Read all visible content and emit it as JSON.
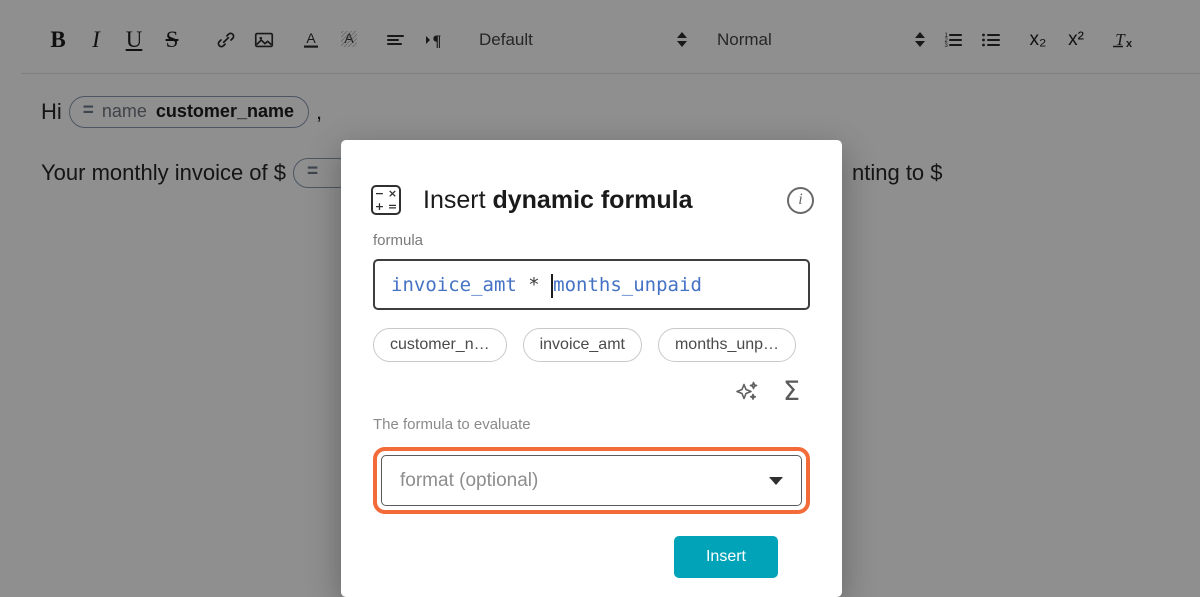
{
  "toolbar": {
    "buttons": [
      {
        "name": "bold",
        "label": "B",
        "icon": "bold-icon"
      },
      {
        "name": "italic",
        "label": "I",
        "icon": "italic-icon"
      },
      {
        "name": "underline",
        "label": "U",
        "icon": "underline-icon"
      },
      {
        "name": "strikethrough",
        "label": "S",
        "icon": "strikethrough-icon"
      },
      {
        "name": "link",
        "label": "🔗",
        "icon": "link-icon"
      },
      {
        "name": "image",
        "label": "🖼",
        "icon": "image-icon"
      },
      {
        "name": "text-color",
        "label": "A",
        "icon": "text-color-icon"
      },
      {
        "name": "highlight",
        "label": "A",
        "icon": "highlight-color-icon"
      },
      {
        "name": "align",
        "label": "≡",
        "icon": "align-left-icon"
      },
      {
        "name": "indent",
        "label": "▸¶",
        "icon": "paragraph-direction-icon"
      }
    ],
    "font_select": {
      "value": "Default"
    },
    "style_select": {
      "value": "Normal"
    },
    "list_buttons": [
      {
        "name": "ordered-list",
        "label": "1⁣2⁣3",
        "icon": "ordered-list-icon"
      },
      {
        "name": "unordered-list",
        "label": "•••",
        "icon": "bullet-list-icon"
      }
    ],
    "script_buttons": [
      {
        "name": "subscript",
        "label": "x₂",
        "icon": "subscript-icon"
      },
      {
        "name": "superscript",
        "label": "x²",
        "icon": "superscript-icon"
      },
      {
        "name": "clear-format",
        "label": "Tx",
        "icon": "clear-formatting-icon"
      }
    ]
  },
  "document": {
    "line1": {
      "prefix": "Hi",
      "chip": {
        "eq": "=",
        "key": "name",
        "value": "customer_name"
      },
      "suffix": ","
    },
    "line2": {
      "prefix": "Your monthly invoice of $",
      "chip": {
        "eq": "=",
        "key": "",
        "value": ""
      },
      "suffix": "nting to $"
    }
  },
  "modal": {
    "icon": "calculator-icon",
    "calc_symbols": [
      "−",
      "×",
      "+",
      "="
    ],
    "title_normal": "Insert ",
    "title_bold": "dynamic formula",
    "info_icon_label": "i",
    "formula": {
      "label": "formula",
      "operand_left": "invoice_amt",
      "operator": " * ",
      "operand_right": "months_unpaid",
      "full_value": "invoice_amt * months_unpaid",
      "text_color": "#4472c4"
    },
    "variable_chips": [
      {
        "label": "customer_n…"
      },
      {
        "label": "invoice_amt"
      },
      {
        "label": "months_unp…"
      }
    ],
    "action_icons": [
      {
        "name": "ai-suggest-icon",
        "label": "✨"
      },
      {
        "name": "sigma-icon",
        "label": "Σ"
      }
    ],
    "helper_text": "The formula to evaluate",
    "format_select": {
      "placeholder": "format (optional)",
      "value": "",
      "highlight_color": "#f26b38"
    },
    "primary_button": {
      "label": "Insert",
      "color": "#00a3b8"
    }
  }
}
